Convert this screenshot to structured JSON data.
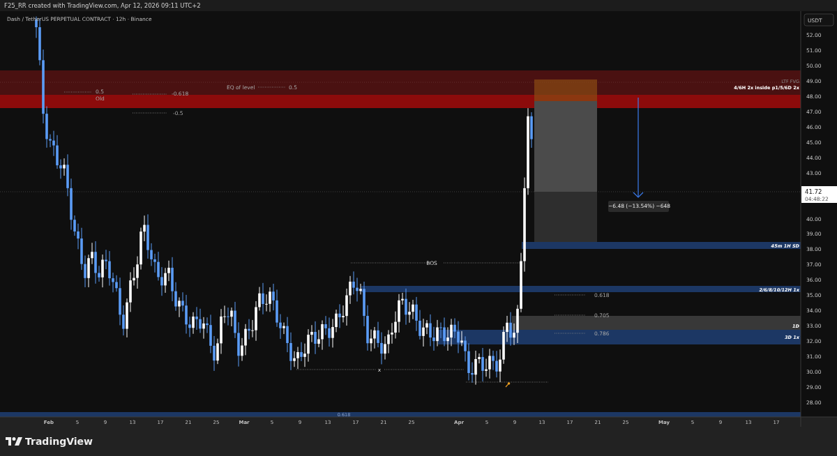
{
  "header": {
    "title": "F25_RR created with TradingView.com, Apr 12, 2026 09:11 UTC+2"
  },
  "chart": {
    "legend": "Dash / TetherUS PERPETUAL CONTRACT · 12h · Binance",
    "currency": "USDT",
    "price_ticks": [
      "52.00",
      "51.00",
      "50.00",
      "49.00",
      "48.00",
      "47.00",
      "46.00",
      "45.00",
      "44.00",
      "43.00",
      "40.00",
      "39.00",
      "38.00",
      "37.00",
      "36.00",
      "35.00",
      "34.00",
      "33.00",
      "32.00",
      "31.00",
      "30.00",
      "29.00",
      "28.00"
    ],
    "last_price": {
      "price": "41.72",
      "countdown": "04:48:22"
    },
    "zones": [
      {
        "kind": "supply",
        "label": "LTF FVG",
        "sublabel": "4/6H 2x inside p1/5/6D 2x"
      },
      {
        "kind": "demand",
        "label": "45m 1H SD"
      },
      {
        "kind": "demand",
        "label": "2/6/8/10/12H 1x"
      },
      {
        "kind": "neutral",
        "label": "1D"
      },
      {
        "kind": "demand",
        "label": "3D 1x"
      },
      {
        "kind": "demand",
        "label": "0.618"
      }
    ],
    "levels": [
      {
        "label": "0.5"
      },
      {
        "label": "Old"
      },
      {
        "label": "-0.618"
      },
      {
        "label": "EQ of level"
      },
      {
        "label": "0.5"
      },
      {
        "label": "-0.5"
      },
      {
        "label": "BOS"
      },
      {
        "label": "x"
      },
      {
        "label": "0.618"
      },
      {
        "label": "0.705"
      },
      {
        "label": "0.786"
      }
    ],
    "measure": {
      "label": "−6.48 (−13.54%) −648"
    },
    "time_ticks": [
      {
        "label": "Feb",
        "major": true
      },
      {
        "label": "5",
        "major": false
      },
      {
        "label": "9",
        "major": false
      },
      {
        "label": "13",
        "major": false
      },
      {
        "label": "17",
        "major": false
      },
      {
        "label": "21",
        "major": false
      },
      {
        "label": "25",
        "major": false
      },
      {
        "label": "Mar",
        "major": true
      },
      {
        "label": "5",
        "major": false
      },
      {
        "label": "9",
        "major": false
      },
      {
        "label": "13",
        "major": false
      },
      {
        "label": "17",
        "major": false
      },
      {
        "label": "21",
        "major": false
      },
      {
        "label": "25",
        "major": false
      },
      {
        "label": "Apr",
        "major": true
      },
      {
        "label": "5",
        "major": false
      },
      {
        "label": "9",
        "major": false
      },
      {
        "label": "13",
        "major": false
      },
      {
        "label": "17",
        "major": false
      },
      {
        "label": "21",
        "major": false
      },
      {
        "label": "25",
        "major": false
      },
      {
        "label": "May",
        "major": true
      },
      {
        "label": "5",
        "major": false
      },
      {
        "label": "9",
        "major": false
      },
      {
        "label": "13",
        "major": false
      },
      {
        "label": "17",
        "major": false
      }
    ]
  },
  "footer": {
    "brand": "TradingView"
  }
}
